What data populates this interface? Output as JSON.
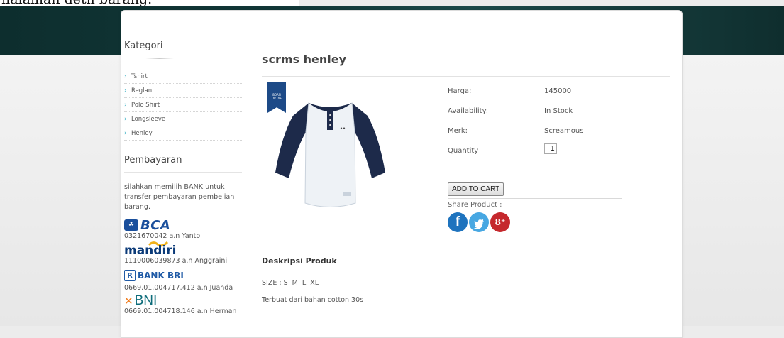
{
  "caption": "halaman detil barang.",
  "sidebar": {
    "category_title": "Kategori",
    "categories": [
      "Tshirt",
      "Reglan",
      "Polo Shirt",
      "Longsleeve",
      "Henley"
    ],
    "payment_title": "Pembayaran",
    "payment_text": "silahkan memilih BANK untuk transfer pembayaran pembelian barang.",
    "banks": [
      {
        "logo": "BCA",
        "account": "0321670042 a.n Yanto"
      },
      {
        "logo": "mandiri",
        "account": "1110006039873 a.n Anggraini"
      },
      {
        "logo": "BANK BRI",
        "account": "0669.01.004717.412 a.n Juanda"
      },
      {
        "logo": "BNI",
        "account": "0669.01.004718.146 a.n Herman"
      }
    ]
  },
  "product": {
    "title": "scrms henley",
    "labels": {
      "price": "Harga:",
      "availability": "Availability:",
      "brand": "Merk:",
      "quantity": "Quantity"
    },
    "price": "145000",
    "availability": "In Stock",
    "brand": "Screamous",
    "quantity": "1",
    "add_to_cart": "ADD TO CART",
    "share_label": "Share Product :",
    "social": {
      "facebook": "f",
      "twitter": "t",
      "googleplus": "8⁺"
    }
  },
  "description": {
    "title": "Deskripsi Produk",
    "size": "SIZE : S  M  L  XL",
    "text": "Terbuat dari bahan cotton 30s"
  },
  "colors": {
    "header": "#123838",
    "link_arrow": "#3ab0c4",
    "navy": "#1d2a4a"
  }
}
